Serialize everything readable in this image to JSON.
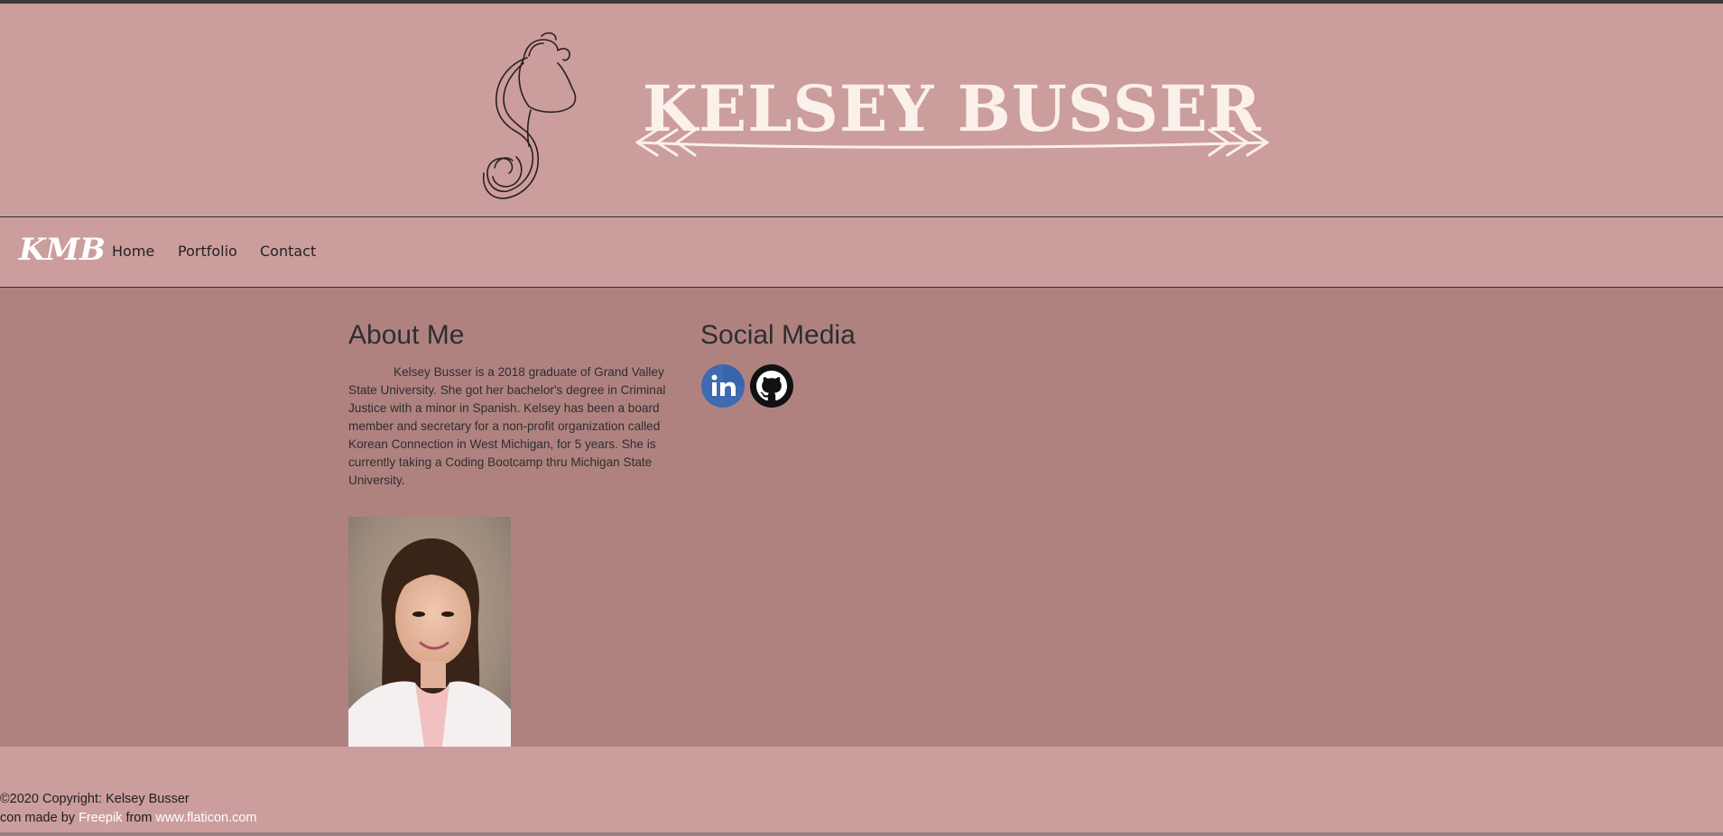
{
  "header": {
    "title": "KELSEY BUSSER",
    "logo_icon": "pitcher-pouring-icon"
  },
  "nav": {
    "brand": "KMB",
    "items": [
      {
        "label": "Home"
      },
      {
        "label": "Portfolio"
      },
      {
        "label": "Contact"
      }
    ]
  },
  "about": {
    "heading": "About Me",
    "text": "Kelsey Busser is a 2018 graduate of Grand Valley State University. She got her bachelor's degree in Criminal Justice with a minor in Spanish. Kelsey has been a board member and secretary for a non-profit organization called Korean Connection in West Michigan, for 5 years. She is currently taking a Coding Bootcamp thru Michigan State University."
  },
  "social": {
    "heading": "Social Media",
    "links": [
      {
        "icon": "linkedin-icon"
      },
      {
        "icon": "github-icon"
      }
    ]
  },
  "footer": {
    "copyright": "©2020 Copyright: Kelsey Busser",
    "credit_prefix": "con made by ",
    "credit_author": "Freepik",
    "credit_middle": " from ",
    "credit_site": "www.flaticon.com"
  },
  "colors": {
    "header_bg": "#cc9d9d",
    "main_bg": "#af8280",
    "title_color": "#fbf0ea",
    "text_color": "#2e2e2e",
    "linkedin_blue": "#3f6bb0"
  }
}
